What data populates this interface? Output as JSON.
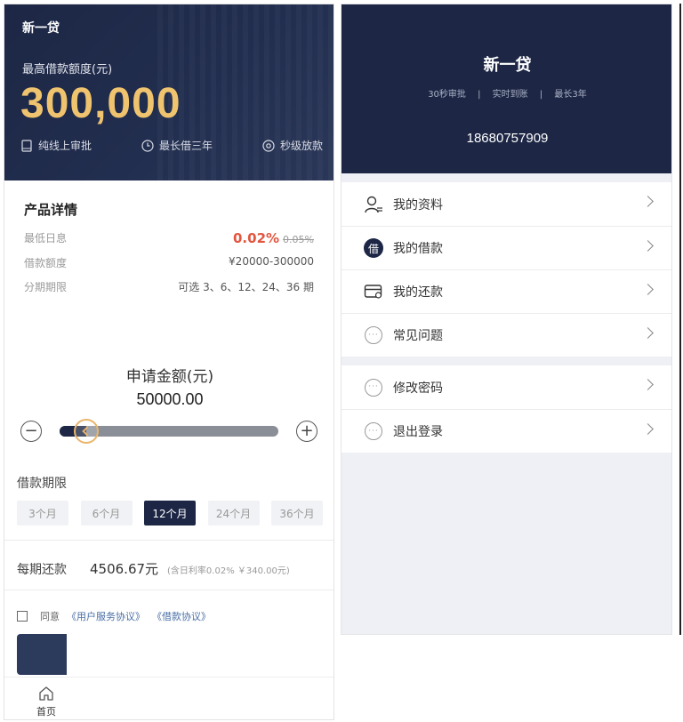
{
  "left": {
    "app_title": "新一贷",
    "limit_label": "最高借款额度(元)",
    "limit_amount": "300,000",
    "features": [
      "纯线上审批",
      "最长借三年",
      "秒级放款"
    ],
    "details": {
      "title": "产品详情",
      "rows": [
        {
          "label": "最低日息",
          "rate_new": "0.02%",
          "rate_old": "0.05%"
        },
        {
          "label": "借款额度",
          "value": "¥20000-300000"
        },
        {
          "label": "分期期限",
          "value": "可选 3、6、12、24、36 期"
        }
      ]
    },
    "amount": {
      "label": "申请金额(元)",
      "value": "50000.00",
      "slider_fraction": 0.12,
      "minus": "−",
      "plus": "+"
    },
    "term": {
      "label": "借款期限",
      "options": [
        "3个月",
        "6个月",
        "12个月",
        "24个月",
        "36个月"
      ],
      "selected": "12个月"
    },
    "repay": {
      "label": "每期还款",
      "amount": "4506.67元",
      "note": "(含日利率0.02% ￥340.00元)"
    },
    "agree": {
      "text": "同意",
      "link1": "《用户服务协议》",
      "link2": "《借款协议》"
    },
    "tab": {
      "home": "首页"
    }
  },
  "right": {
    "title": "新一贷",
    "sub": [
      "30秒审批",
      "实时到账",
      "最长3年"
    ],
    "sub_sep": "|",
    "phone": "18680757909",
    "menu1": [
      "我的资料",
      "我的借款",
      "我的还款",
      "常见问题"
    ],
    "menu2": [
      "修改密码",
      "退出登录"
    ],
    "borrow_glyph": "借",
    "dots_glyph": "···"
  },
  "colors": {
    "navy": "#1d2745",
    "gold": "#f0c46e",
    "red": "#e2553f",
    "link": "#4a6fa5"
  }
}
